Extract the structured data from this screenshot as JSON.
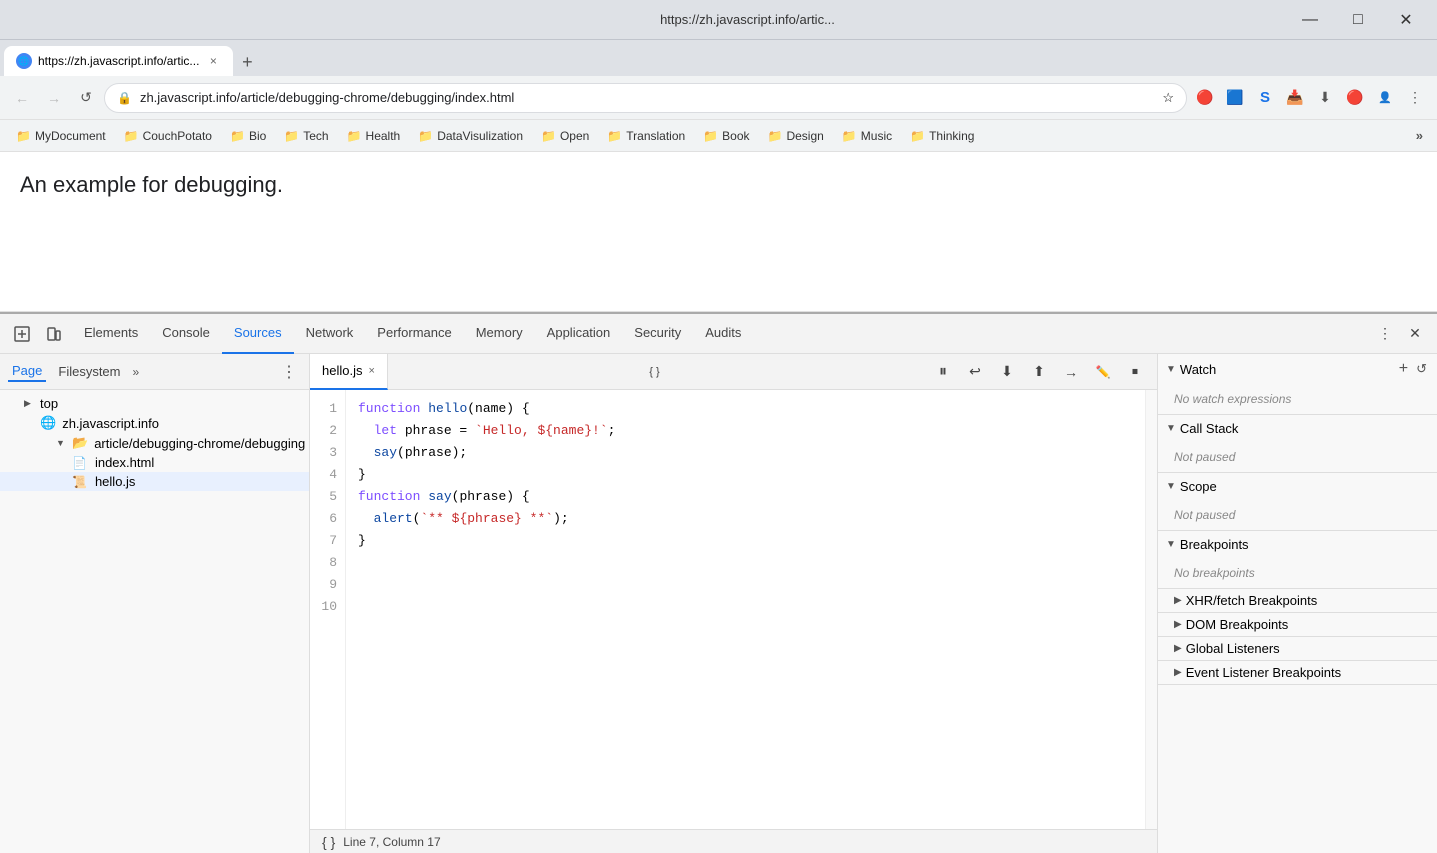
{
  "window": {
    "title": "https://zh.javascript.info/artic...",
    "min_label": "—",
    "max_label": "□",
    "close_label": "✕"
  },
  "tab": {
    "url_display": "https://zh.javascript.info/artic...",
    "favicon": "🌐",
    "close": "×"
  },
  "address_bar": {
    "url": "zh.javascript.info/article/debugging-chrome/debugging/index.html",
    "back": "←",
    "forward": "→",
    "refresh": "↺",
    "star": "☆",
    "lock": "🔒",
    "extensions": [
      "🔴",
      "🟦",
      "S",
      "📥",
      "⬇",
      "🔴"
    ],
    "menu": "⋮"
  },
  "bookmarks": [
    {
      "label": "MyDocument",
      "icon": "📁"
    },
    {
      "label": "CouchPotato",
      "icon": "📁"
    },
    {
      "label": "Bio",
      "icon": "📁"
    },
    {
      "label": "Tech",
      "icon": "📁"
    },
    {
      "label": "Health",
      "icon": "📁"
    },
    {
      "label": "DataVisulization",
      "icon": "📁"
    },
    {
      "label": "Open",
      "icon": "📁"
    },
    {
      "label": "Translation",
      "icon": "📁"
    },
    {
      "label": "Book",
      "icon": "📁"
    },
    {
      "label": "Design",
      "icon": "📁"
    },
    {
      "label": "Music",
      "icon": "📁"
    },
    {
      "label": "Thinking",
      "icon": "📁"
    }
  ],
  "page": {
    "heading": "An example for debugging."
  },
  "devtools": {
    "tabs": [
      {
        "label": "Elements",
        "active": false
      },
      {
        "label": "Console",
        "active": false
      },
      {
        "label": "Sources",
        "active": true
      },
      {
        "label": "Network",
        "active": false
      },
      {
        "label": "Performance",
        "active": false
      },
      {
        "label": "Memory",
        "active": false
      },
      {
        "label": "Application",
        "active": false
      },
      {
        "label": "Security",
        "active": false
      },
      {
        "label": "Audits",
        "active": false
      }
    ],
    "file_tree": {
      "tabs": [
        "Page",
        "Filesystem"
      ],
      "more": "»",
      "items": [
        {
          "label": "top",
          "indent": 0,
          "type": "root",
          "expanded": false
        },
        {
          "label": "zh.javascript.info",
          "indent": 1,
          "type": "domain",
          "expanded": true
        },
        {
          "label": "article/debugging-chrome/debugging",
          "indent": 2,
          "type": "folder",
          "expanded": true
        },
        {
          "label": "index.html",
          "indent": 3,
          "type": "file"
        },
        {
          "label": "hello.js",
          "indent": 3,
          "type": "file",
          "selected": true
        }
      ]
    },
    "code_editor": {
      "filename": "hello.js",
      "lines": [
        {
          "num": 1,
          "code": "function hello(name) {"
        },
        {
          "num": 2,
          "code": "  let phrase = `Hello, ${name}!`;"
        },
        {
          "num": 3,
          "code": ""
        },
        {
          "num": 4,
          "code": "  say(phrase);"
        },
        {
          "num": 5,
          "code": "}"
        },
        {
          "num": 6,
          "code": ""
        },
        {
          "num": 7,
          "code": "function say(phrase) {"
        },
        {
          "num": 8,
          "code": "  alert(`** ${phrase} **`);"
        },
        {
          "num": 9,
          "code": "}"
        },
        {
          "num": 10,
          "code": ""
        }
      ],
      "status": "Line 7, Column 17"
    },
    "right_panel": {
      "watch": {
        "label": "Watch",
        "empty_text": "No watch expressions"
      },
      "call_stack": {
        "label": "Call Stack",
        "empty_text": "Not paused"
      },
      "scope": {
        "label": "Scope",
        "empty_text": "Not paused"
      },
      "breakpoints": {
        "label": "Breakpoints",
        "empty_text": "No breakpoints"
      },
      "xhr_breakpoints": {
        "label": "XHR/fetch Breakpoints"
      },
      "dom_breakpoints": {
        "label": "DOM Breakpoints"
      },
      "global_listeners": {
        "label": "Global Listeners"
      },
      "event_breakpoints": {
        "label": "Event Listener Breakpoints"
      }
    },
    "debug_toolbar": {
      "pause": "⏸",
      "step_over": "↪",
      "step_into": "⬇",
      "step_out": "⬆",
      "step": "→",
      "deactivate": "🚫",
      "async": "⏹"
    }
  }
}
